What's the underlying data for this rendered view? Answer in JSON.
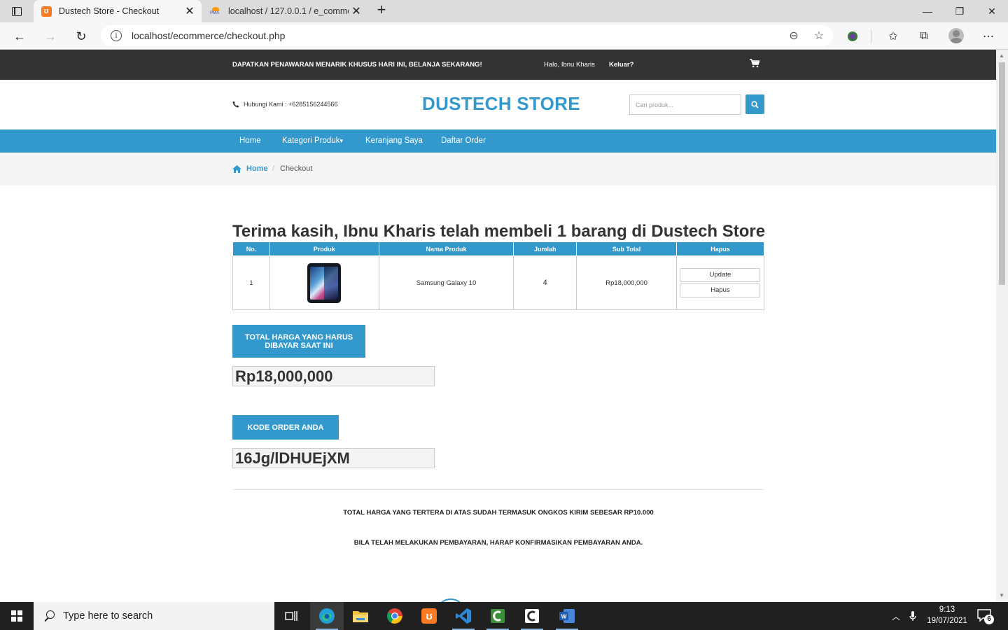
{
  "browser": {
    "tabs": [
      {
        "title": "Dustech Store - Checkout",
        "active": true
      },
      {
        "title": "localhost / 127.0.0.1 / e_commerce",
        "active": false
      }
    ],
    "url": "localhost/ecommerce/checkout.php"
  },
  "topbar": {
    "promo": "DAPATKAN PENAWARAN MENARIK KHUSUS HARI INI, BELANJA SEKARANG!",
    "greeting": "Halo, Ibnu Kharis",
    "logout": "Keluar?"
  },
  "header": {
    "contact": "Hubungi Kami : +6285156244566",
    "brand": "DUSTECH STORE",
    "search_placeholder": "Cari produk..."
  },
  "nav": {
    "items": [
      "Home",
      "Kategori Produk",
      "Keranjang Saya",
      "Daftar Order"
    ]
  },
  "breadcrumb": {
    "home": "Home",
    "current": "Checkout"
  },
  "checkout": {
    "thanks": "Terima kasih, Ibnu Kharis telah membeli 1 barang di Dustech Store",
    "table": {
      "headers": [
        "No.",
        "Produk",
        "Nama Produk",
        "Jumlah",
        "Sub Total",
        "Hapus"
      ],
      "rows": [
        {
          "no": "1",
          "name": "Samsung Galaxy 10",
          "qty": "4",
          "subtotal": "Rp18,000,000",
          "update_label": "Update",
          "delete_label": "Hapus"
        }
      ]
    },
    "total_label": "TOTAL HARGA YANG HARUS DIBAYAR SAAT INI",
    "total_value": "Rp18,000,000",
    "order_code_label": "KODE ORDER ANDA",
    "order_code_value": "16Jg/lDHUEjXM",
    "note_shipping": "TOTAL HARGA YANG TERTERA DI ATAS SUDAH TERMASUK ONGKOS KIRIM SEBESAR RP10.000",
    "note_confirm": "BILA TELAH MELAKUKAN PEMBAYARAN, HARAP KONFIRMASIKAN PEMBAYARAN ANDA."
  },
  "taskbar": {
    "search_placeholder": "Type here to search",
    "time": "9:13",
    "date": "19/07/2021",
    "notification_count": "6"
  },
  "colors": {
    "accent": "#3399cc",
    "topbar": "#333333"
  }
}
